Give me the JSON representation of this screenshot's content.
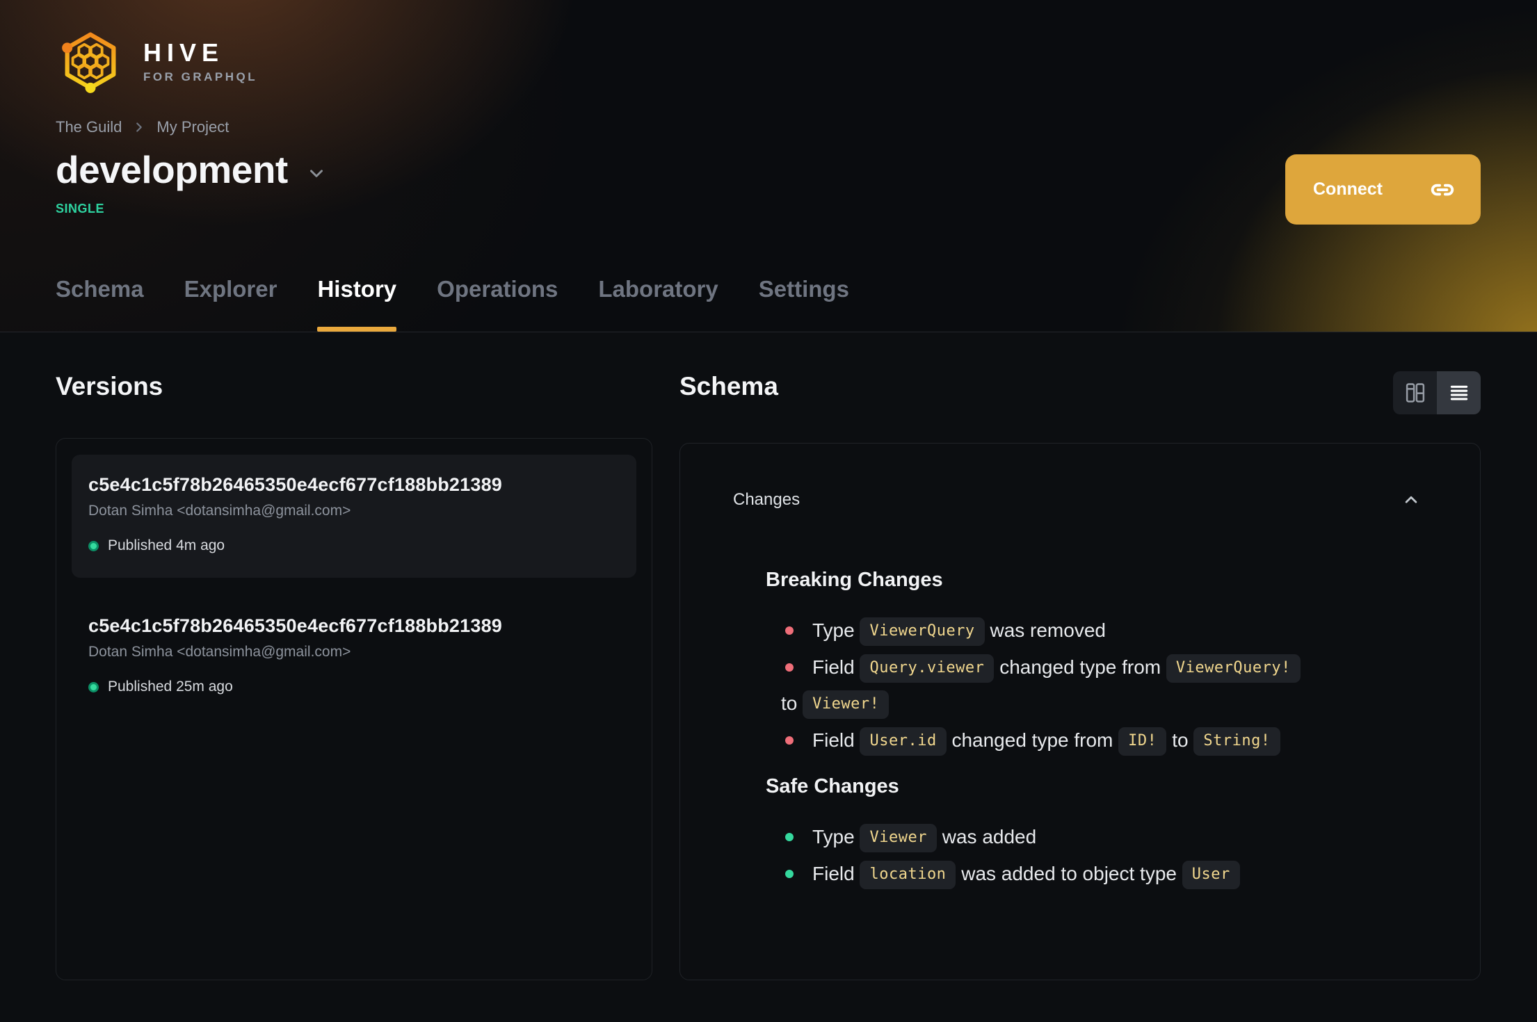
{
  "brand": {
    "name": "HIVE",
    "tagline": "FOR GRAPHQL"
  },
  "breadcrumb": {
    "items": [
      "The Guild",
      "My Project"
    ]
  },
  "target": {
    "name": "development",
    "mode": "SINGLE"
  },
  "connect": {
    "label": "Connect"
  },
  "tabs": {
    "items": [
      {
        "label": "Schema",
        "active": false
      },
      {
        "label": "Explorer",
        "active": false
      },
      {
        "label": "History",
        "active": true
      },
      {
        "label": "Operations",
        "active": false
      },
      {
        "label": "Laboratory",
        "active": false
      },
      {
        "label": "Settings",
        "active": false
      }
    ]
  },
  "versions": {
    "title": "Versions",
    "items": [
      {
        "hash": "c5e4c1c5f78b26465350e4ecf677cf188bb21389",
        "author": "Dotan Simha <dotansimha@gmail.com>",
        "status": "Published 4m ago",
        "highlighted": true
      },
      {
        "hash": "c5e4c1c5f78b26465350e4ecf677cf188bb21389",
        "author": "Dotan Simha <dotansimha@gmail.com>",
        "status": "Published 25m ago",
        "highlighted": false
      }
    ]
  },
  "schema": {
    "title": "Schema",
    "changes": {
      "label": "Changes",
      "sections": [
        {
          "title": "Breaking Changes",
          "severity": "breaking",
          "items": [
            {
              "parts": [
                {
                  "t": "text",
                  "v": "Type "
                },
                {
                  "t": "code",
                  "v": "ViewerQuery"
                },
                {
                  "t": "text",
                  "v": " was removed"
                }
              ]
            },
            {
              "parts": [
                {
                  "t": "text",
                  "v": "Field "
                },
                {
                  "t": "code",
                  "v": "Query.viewer"
                },
                {
                  "t": "text",
                  "v": " changed type from "
                },
                {
                  "t": "code",
                  "v": "ViewerQuery!"
                },
                {
                  "t": "br"
                },
                {
                  "t": "text",
                  "v": "to "
                },
                {
                  "t": "code",
                  "v": "Viewer!"
                }
              ]
            },
            {
              "parts": [
                {
                  "t": "text",
                  "v": "Field "
                },
                {
                  "t": "code",
                  "v": "User.id"
                },
                {
                  "t": "text",
                  "v": " changed type from "
                },
                {
                  "t": "code",
                  "v": "ID!"
                },
                {
                  "t": "text",
                  "v": " to "
                },
                {
                  "t": "code",
                  "v": "String!"
                }
              ]
            }
          ]
        },
        {
          "title": "Safe Changes",
          "severity": "safe",
          "items": [
            {
              "parts": [
                {
                  "t": "text",
                  "v": "Type "
                },
                {
                  "t": "code",
                  "v": "Viewer"
                },
                {
                  "t": "text",
                  "v": " was added"
                }
              ]
            },
            {
              "parts": [
                {
                  "t": "text",
                  "v": "Field "
                },
                {
                  "t": "code",
                  "v": "location"
                },
                {
                  "t": "text",
                  "v": " was added to object type "
                },
                {
                  "t": "code",
                  "v": "User"
                }
              ]
            }
          ]
        }
      ]
    }
  },
  "icons": {
    "logo": "hive-hexagon-honeycomb",
    "breadcrumb_separator": "chevron-right",
    "target_selector": "chevron-down",
    "connect": "link",
    "changes_collapse": "chevron-up",
    "view_side_by_side": "columns",
    "view_list": "list",
    "published_status": "green-dot"
  },
  "colors": {
    "accent_underline": "#eaa93d",
    "connect_button": "#dea63c",
    "single_badge": "#2ed3a0",
    "breaking_bullet": "#ef6e79",
    "safe_bullet": "#35d89e",
    "chip_text": "#f1d78e",
    "published_dot": "#35dc9f"
  }
}
